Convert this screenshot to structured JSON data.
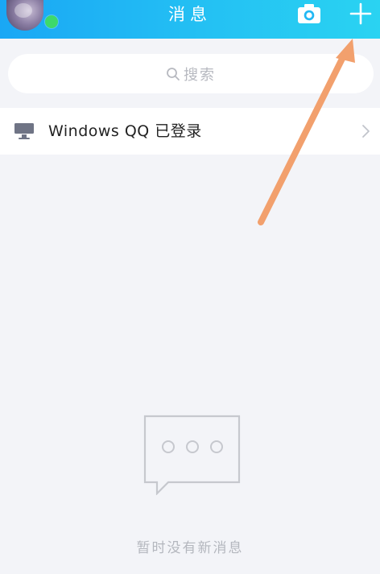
{
  "header": {
    "title": "消息",
    "avatar_icon": "avatar",
    "online_icon": "online-dot-icon",
    "camera_icon": "camera-icon",
    "add_icon": "plus-icon"
  },
  "search": {
    "placeholder": "搜索",
    "icon": "search-icon"
  },
  "notice": {
    "label": "Windows QQ 已登录",
    "icon": "monitor-icon",
    "chevron_icon": "chevron-right-icon"
  },
  "empty_state": {
    "text": "暂时没有新消息",
    "icon": "chat-bubble-icon"
  },
  "colors": {
    "header_start": "#1aa7f5",
    "header_end": "#2ad3f2",
    "background": "#f3f4f8",
    "annotation_arrow": "#f2a06d",
    "online_dot": "#3dd96b"
  }
}
